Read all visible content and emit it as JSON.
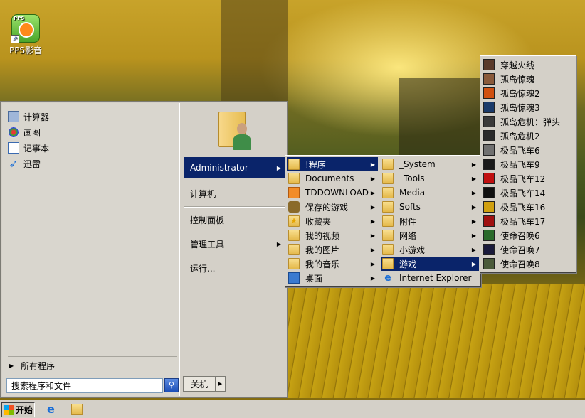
{
  "desktop": {
    "icons": [
      {
        "label": "PPS影音",
        "icon": "pps-player-icon"
      }
    ]
  },
  "start_menu": {
    "pinned": [
      {
        "label": "计算器",
        "icon": "calculator-icon"
      },
      {
        "label": "画图",
        "icon": "paint-icon"
      },
      {
        "label": "记事本",
        "icon": "notepad-icon"
      },
      {
        "label": "迅雷",
        "icon": "thunder-icon"
      }
    ],
    "all_programs": "所有程序",
    "search_placeholder": "搜索程序和文件",
    "right": {
      "administrator": "Administrator",
      "computer": "计算机",
      "control_panel": "控制面板",
      "admin_tools": "管理工具",
      "run": "运行..."
    },
    "shutdown": "关机"
  },
  "menu1": [
    {
      "label": "!程序",
      "selected": true,
      "sub": true
    },
    {
      "label": "Documents",
      "sub": true
    },
    {
      "label": "TDDOWNLOAD",
      "sub": true
    },
    {
      "label": "保存的游戏",
      "sub": true
    },
    {
      "label": "收藏夹",
      "sub": true
    },
    {
      "label": "我的视频",
      "sub": true
    },
    {
      "label": "我的图片",
      "sub": true
    },
    {
      "label": "我的音乐",
      "sub": true
    },
    {
      "label": "桌面",
      "sub": true
    }
  ],
  "menu2": [
    {
      "label": "_System",
      "sub": true
    },
    {
      "label": "_Tools",
      "sub": true
    },
    {
      "label": "Media",
      "sub": true
    },
    {
      "label": "Softs",
      "sub": true
    },
    {
      "label": "附件",
      "sub": true
    },
    {
      "label": "网络",
      "sub": true
    },
    {
      "label": "小游戏",
      "sub": true
    },
    {
      "label": "游戏",
      "selected": true,
      "sub": true
    },
    {
      "label": "Internet Explorer",
      "sub": false
    }
  ],
  "menu3": [
    {
      "label": "穿越火线",
      "color": "#5a3a2a"
    },
    {
      "label": "孤岛惊魂",
      "color": "#8a5a3a"
    },
    {
      "label": "孤岛惊魂2",
      "color": "#d05010"
    },
    {
      "label": "孤岛惊魂3",
      "color": "#1a3a6a"
    },
    {
      "label": "孤岛危机：弹头",
      "color": "#3a3a3a"
    },
    {
      "label": "孤岛危机2",
      "color": "#2a2a2a"
    },
    {
      "label": "极品飞车6",
      "color": "#707070"
    },
    {
      "label": "极品飞车9",
      "color": "#1a1a1a"
    },
    {
      "label": "极品飞车12",
      "color": "#c01010"
    },
    {
      "label": "极品飞车14",
      "color": "#101010"
    },
    {
      "label": "极品飞车16",
      "color": "#d0a010"
    },
    {
      "label": "极品飞车17",
      "color": "#a01010"
    },
    {
      "label": "使命召唤6",
      "color": "#2a6a2a"
    },
    {
      "label": "使命召唤7",
      "color": "#1a1a3a"
    },
    {
      "label": "使命召唤8",
      "color": "#4a5a3a"
    }
  ],
  "taskbar": {
    "start": "开始",
    "quicklaunch": [
      "internet-explorer-icon",
      "explorer-folder-icon"
    ]
  }
}
